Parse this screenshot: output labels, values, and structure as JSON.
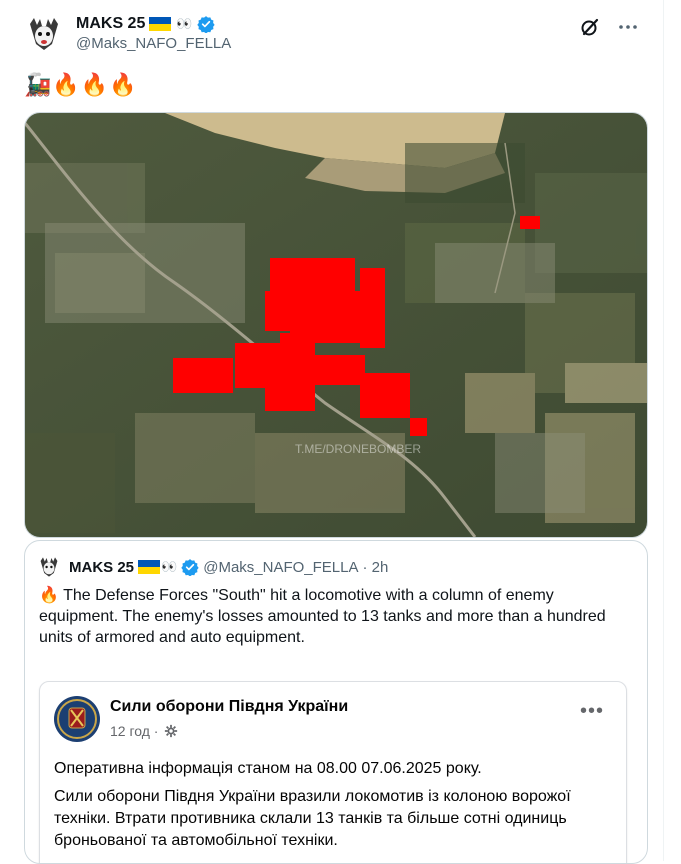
{
  "author": {
    "display_name": "MAKS 25",
    "handle": "@Maks_NAFO_FELLA",
    "eyes": "👀",
    "verified": true
  },
  "tweet": {
    "emoji_text": "🚂🔥🔥🔥"
  },
  "map": {
    "watermark": "T.ME/DRONEBOMBER",
    "highlight_color": "#ff0000"
  },
  "quote": {
    "display_name": "MAKS 25",
    "handle": "@Maks_NAFO_FELLA",
    "time": "· 2h",
    "fire_emoji": "🔥",
    "text": "The Defense Forces \"South\" hit a locomotive with a column of enemy equipment. The enemy's losses amounted to 13 tanks and more than a hundred units of armored and auto equipment.",
    "embedded": {
      "page_name": "Сили оборони Півдня України",
      "time": "12 год ·",
      "line1": "Оперативна інформація станом на 08.00 07.06.2025 року.",
      "line2": "Сили оборони Півдня України вразили локомотив із колоною ворожої техніки. Втрати противника склали 13 танків та більше сотні одиниць броньованої та автомобільної техніки."
    }
  },
  "colors": {
    "verified_blue": "#1d9bf0",
    "flag_blue": "#0057b7",
    "flag_yellow": "#ffd700"
  }
}
